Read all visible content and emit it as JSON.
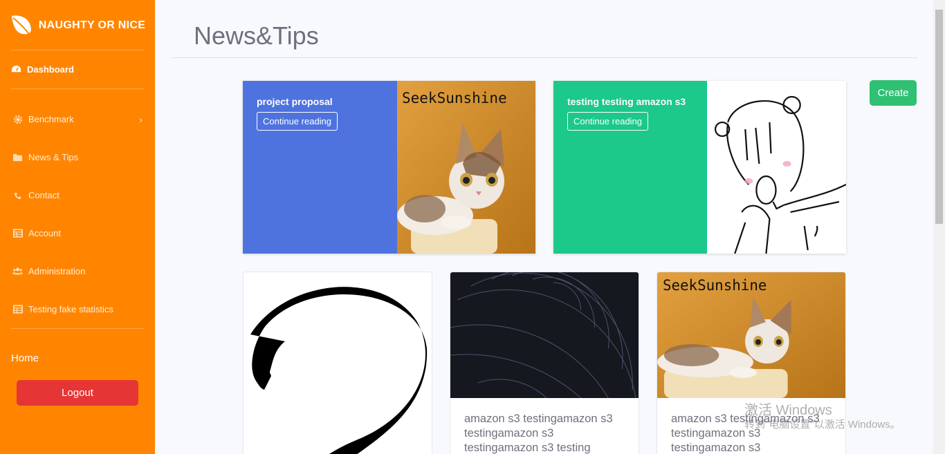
{
  "sidebar": {
    "brand": "NAUGHTY OR NICE",
    "dashboard": "Dashboard",
    "items": [
      {
        "label": "Benchmark",
        "icon": "gear-icon"
      },
      {
        "label": "News & Tips",
        "icon": "folder-icon"
      },
      {
        "label": "Contact",
        "icon": "phone-icon"
      },
      {
        "label": "Account",
        "icon": "table-icon"
      },
      {
        "label": "Administration",
        "icon": "users-icon"
      },
      {
        "label": "Testing fake statistics",
        "icon": "table-icon"
      }
    ],
    "home": "Home",
    "logout": "Logout"
  },
  "main": {
    "title": "News&Tips",
    "create_label": "Create",
    "featured": [
      {
        "title": "project proposal",
        "button": "Continue reading",
        "bg": "#4e73df",
        "image_text": "SeekSunshine"
      },
      {
        "title": "testing testing amazon s3",
        "button": "Continue reading",
        "bg": "#1cc88a"
      }
    ],
    "cards": [
      {
        "text": ""
      },
      {
        "text": "amazon s3 testingamazon s3 testingamazon s3 testingamazon s3 testing"
      },
      {
        "text": "amazon s3 testingamazon s3 testingamazon s3 testingamazon s3",
        "image_text": "SeekSunshine"
      }
    ]
  },
  "watermark": {
    "line1": "激活 Windows",
    "line2": "转到\"电脑设置\"以激活 Windows。"
  }
}
